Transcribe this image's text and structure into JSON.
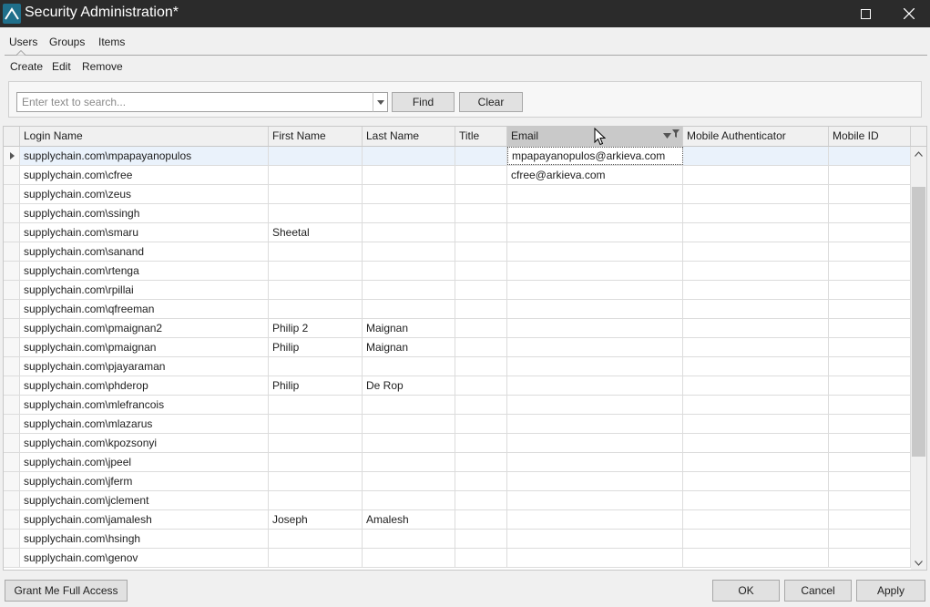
{
  "window": {
    "title": "Security Administration*",
    "app_icon": "arkieva-logo-icon",
    "controls": [
      "maximize-icon",
      "close-icon"
    ]
  },
  "tabs": [
    {
      "label": "Users",
      "active": true
    },
    {
      "label": "Groups",
      "active": false
    },
    {
      "label": "Items",
      "active": false
    }
  ],
  "actions": {
    "create": "Create",
    "edit": "Edit",
    "remove": "Remove"
  },
  "search": {
    "placeholder": "Enter text to search...",
    "value": "",
    "find_label": "Find",
    "clear_label": "Clear"
  },
  "grid": {
    "columns": [
      "Login Name",
      "First Name",
      "Last Name",
      "Title",
      "Email",
      "Mobile Authenticator",
      "Mobile ID"
    ],
    "sorted_column": "Email",
    "rows": [
      [
        "supplychain.com\\mpapayanopulos",
        "",
        "",
        "",
        "mpapayanopulos@arkieva.com",
        "",
        ""
      ],
      [
        "supplychain.com\\cfree",
        "",
        "",
        "",
        "cfree@arkieva.com",
        "",
        ""
      ],
      [
        "supplychain.com\\zeus",
        "",
        "",
        "",
        "",
        "",
        ""
      ],
      [
        "supplychain.com\\ssingh",
        "",
        "",
        "",
        "",
        "",
        ""
      ],
      [
        "supplychain.com\\smaru",
        "Sheetal",
        "",
        "",
        "",
        "",
        ""
      ],
      [
        "supplychain.com\\sanand",
        "",
        "",
        "",
        "",
        "",
        ""
      ],
      [
        "supplychain.com\\rtenga",
        "",
        "",
        "",
        "",
        "",
        ""
      ],
      [
        "supplychain.com\\rpillai",
        "",
        "",
        "",
        "",
        "",
        ""
      ],
      [
        "supplychain.com\\qfreeman",
        "",
        "",
        "",
        "",
        "",
        ""
      ],
      [
        "supplychain.com\\pmaignan2",
        "Philip 2",
        "Maignan",
        "",
        "",
        "",
        ""
      ],
      [
        "supplychain.com\\pmaignan",
        "Philip",
        "Maignan",
        "",
        "",
        "",
        ""
      ],
      [
        "supplychain.com\\pjayaraman",
        "",
        "",
        "",
        "",
        "",
        ""
      ],
      [
        "supplychain.com\\phderop",
        "Philip",
        "De Rop",
        "",
        "",
        "",
        ""
      ],
      [
        "supplychain.com\\mlefrancois",
        "",
        "",
        "",
        "",
        "",
        ""
      ],
      [
        "supplychain.com\\mlazarus",
        "",
        "",
        "",
        "",
        "",
        ""
      ],
      [
        "supplychain.com\\kpozsonyi",
        "",
        "",
        "",
        "",
        "",
        ""
      ],
      [
        "supplychain.com\\jpeel",
        "",
        "",
        "",
        "",
        "",
        ""
      ],
      [
        "supplychain.com\\jferm",
        "",
        "",
        "",
        "",
        "",
        ""
      ],
      [
        "supplychain.com\\jclement",
        "",
        "",
        "",
        "",
        "",
        ""
      ],
      [
        "supplychain.com\\jamalesh",
        "Joseph",
        "Amalesh",
        "",
        "",
        "",
        ""
      ],
      [
        "supplychain.com\\hsingh",
        "",
        "",
        "",
        "",
        "",
        ""
      ],
      [
        "supplychain.com\\genov",
        "",
        "",
        "",
        "",
        "",
        ""
      ]
    ],
    "selected_row": 0
  },
  "footer": {
    "grant_label": "Grant Me Full Access",
    "ok_label": "OK",
    "cancel_label": "Cancel",
    "apply_label": "Apply"
  }
}
